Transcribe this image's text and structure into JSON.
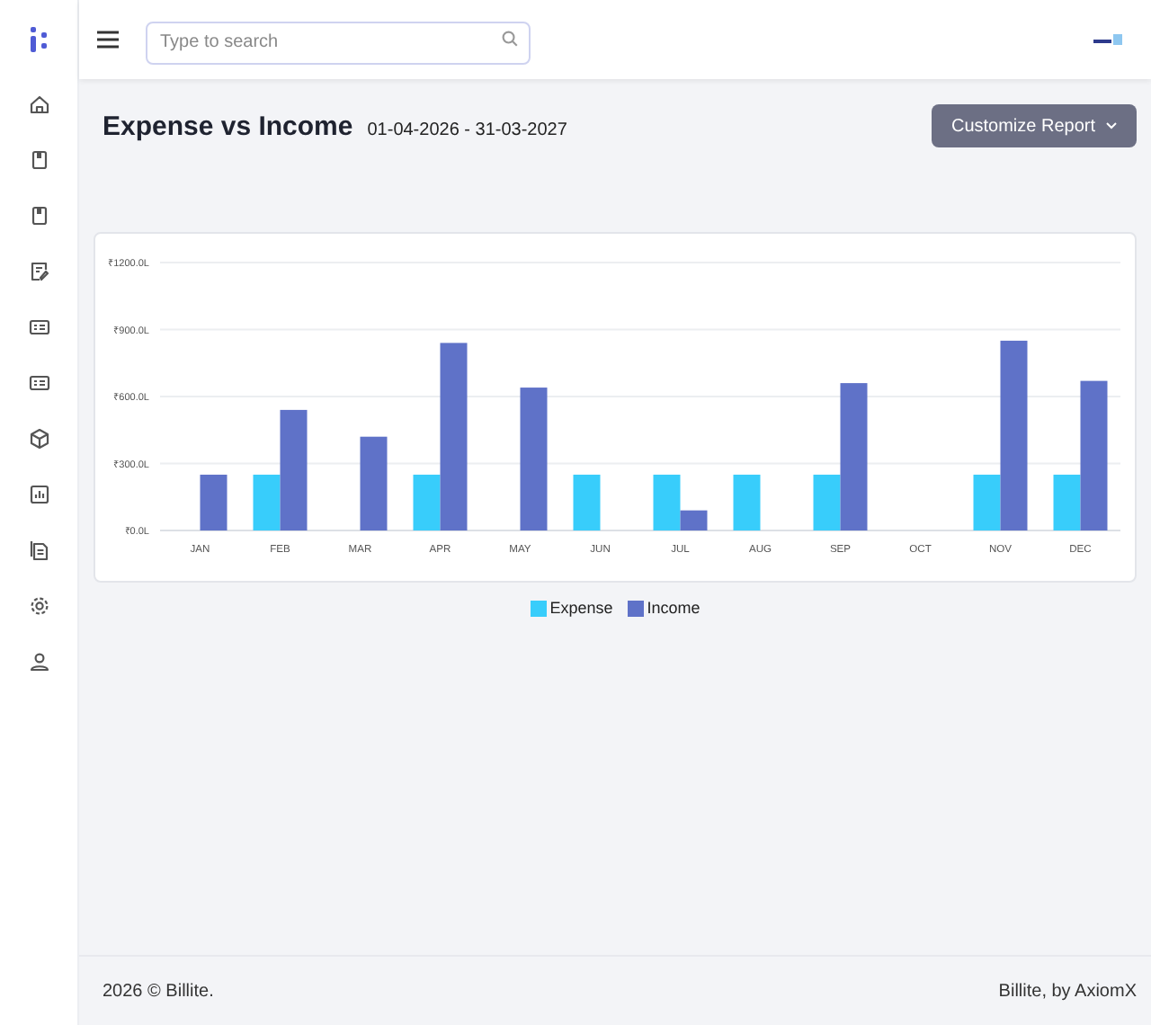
{
  "header": {
    "search": {
      "placeholder": "Type to search"
    }
  },
  "sidebar": {
    "items": [
      {
        "kind": "home"
      },
      {
        "kind": "book"
      },
      {
        "kind": "book"
      },
      {
        "kind": "edit"
      },
      {
        "kind": "card"
      },
      {
        "kind": "card"
      },
      {
        "kind": "box"
      },
      {
        "kind": "chart"
      },
      {
        "kind": "document"
      },
      {
        "kind": "settings"
      },
      {
        "kind": "user"
      }
    ]
  },
  "page": {
    "title": "Expense vs Income",
    "date_range": "01-04-2026 - 31-03-2027",
    "button": "Customize Report"
  },
  "chart_data": {
    "type": "bar",
    "categories": [
      "JAN",
      "FEB",
      "MAR",
      "APR",
      "MAY",
      "JUN",
      "JUL",
      "AUG",
      "SEP",
      "OCT",
      "NOV",
      "DEC"
    ],
    "series": [
      {
        "name": "Expense",
        "color": "#38cdfb",
        "values": [
          0,
          250,
          0,
          250,
          0,
          250,
          250,
          250,
          250,
          0,
          250,
          250
        ]
      },
      {
        "name": "Income",
        "color": "#5f72c8",
        "values": [
          250,
          540,
          420,
          840,
          640,
          0,
          90,
          0,
          660,
          0,
          850,
          670
        ]
      }
    ],
    "grid": true,
    "ylim": [
      0,
      1200
    ],
    "yticks": [
      {
        "value": 0,
        "label": "₹0.0L"
      },
      {
        "value": 300,
        "label": "₹300.0L"
      },
      {
        "value": 600,
        "label": "₹600.0L"
      },
      {
        "value": 900,
        "label": "₹900.0L"
      },
      {
        "value": 1200,
        "label": "₹1200.0L"
      }
    ]
  },
  "footer": {
    "left": "2026 © Billite.",
    "right": "Billite, by AxiomX"
  }
}
